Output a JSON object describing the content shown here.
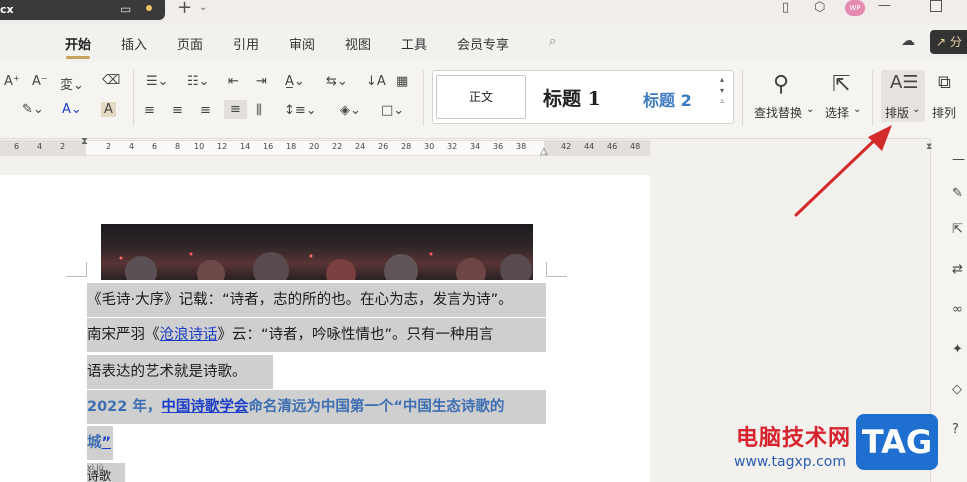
{
  "title_bar": {
    "doc_tab": "cx",
    "avatar": "WP"
  },
  "menu": {
    "items": [
      "开始",
      "插入",
      "页面",
      "引用",
      "审阅",
      "视图",
      "工具",
      "会员专享"
    ],
    "share": "分"
  },
  "ribbon": {
    "styles": {
      "normal": "正文",
      "h1": "标题 1",
      "h2": "标题 2"
    },
    "find_replace": "查找替换",
    "select": "选择",
    "layout": "排版",
    "arrange": "排列"
  },
  "ruler": {
    "ticks": [
      "6",
      "4",
      "2",
      "2",
      "4",
      "6",
      "8",
      "10",
      "12",
      "14",
      "16",
      "18",
      "20",
      "22",
      "24",
      "26",
      "28",
      "30",
      "32",
      "34",
      "36",
      "38",
      "42",
      "44",
      "46",
      "48"
    ]
  },
  "document": {
    "line1": "《毛诗·大序》记载：“诗者，志的所的也。在心为志，发言为诗”。",
    "line2_pre": "南宋严羽《",
    "line2_link": "沧浪诗话",
    "line2_post": "》云：“诗者，吟咏性情也”。只有一种用言",
    "line3": "语表达的艺术就是诗歌。",
    "line4_pre": "2022 年，",
    "line4_link": "中国诗歌学会",
    "line4_post": "命名清远为中国第一个“中国生态诗歌的",
    "line5_pre": "城",
    "line5_link": "”",
    "line6": "xi jù",
    "line6b": "诗歌"
  },
  "watermark": {
    "cn": "电脑技术网",
    "url": "www.tagxp.com",
    "tag": "TAG"
  },
  "colors": {
    "accent": "#c8a25d",
    "arrow": "#d32a2a",
    "link": "#1a3ec8",
    "heading_blue": "#3f6fb3"
  }
}
